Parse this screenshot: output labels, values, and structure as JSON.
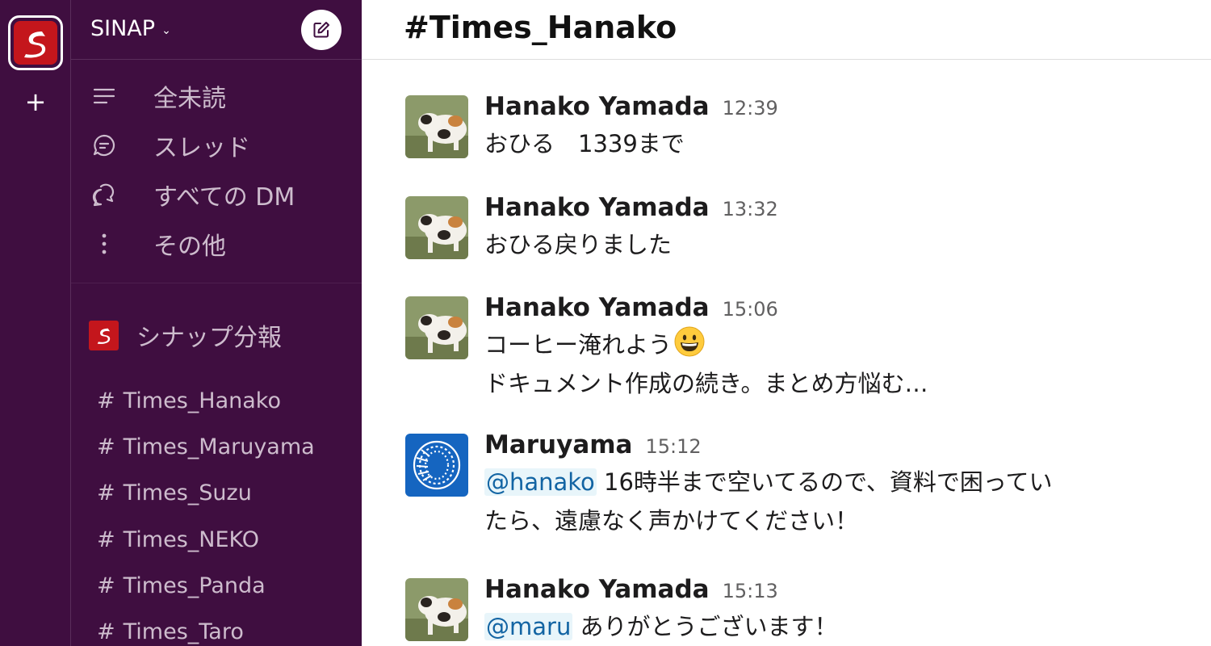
{
  "workspace": {
    "name": "SINAP",
    "add_label": "+"
  },
  "sidebar": {
    "nav": [
      {
        "label": "全未読",
        "icon": "list-icon"
      },
      {
        "label": "スレッド",
        "icon": "thread-icon"
      },
      {
        "label": "すべての DM",
        "icon": "dm-icon"
      },
      {
        "label": "その他",
        "icon": "more-vertical-icon"
      }
    ],
    "section_title": "シナップ分報",
    "channels": [
      "Times_Hanako",
      "Times_Maruyama",
      "Times_Suzu",
      "Times_NEKO",
      "Times_Panda",
      "Times_Taro"
    ],
    "hash": "#"
  },
  "channel": {
    "title": "#Times_Hanako"
  },
  "messages": [
    {
      "author": "Hanako Yamada",
      "time": "12:39",
      "avatar": "cat-photo-avatar",
      "lines": [
        "おひる　1339まで"
      ]
    },
    {
      "author": "Hanako Yamada",
      "time": "13:32",
      "avatar": "cat-photo-avatar",
      "lines": [
        "おひる戻りました"
      ]
    },
    {
      "author": "Hanako Yamada",
      "time": "15:06",
      "avatar": "cat-photo-avatar",
      "lines": [
        "コーヒー淹れよう",
        "ドキュメント作成の続き。まとめ方悩む…"
      ],
      "emoji": "grinning-face-icon"
    },
    {
      "author": "Maruyama",
      "time": "15:12",
      "avatar": "blue-spiral-avatar",
      "mention": "@hanako",
      "lines": [
        "16時半まで空いてるので、資料で困ってい",
        "たら、遠慮なく声かけてください！"
      ]
    },
    {
      "author": "Hanako Yamada",
      "time": "15:13",
      "avatar": "cat-photo-avatar",
      "mention": "@maru",
      "lines": [
        "ありがとうございます！"
      ]
    }
  ],
  "colors": {
    "sidebar_bg": "#3f0e40",
    "brand_red": "#c4161c",
    "mention_bg": "#e8f5fa",
    "mention_text": "#1264a3",
    "maruyama_blue": "#1565c0"
  }
}
